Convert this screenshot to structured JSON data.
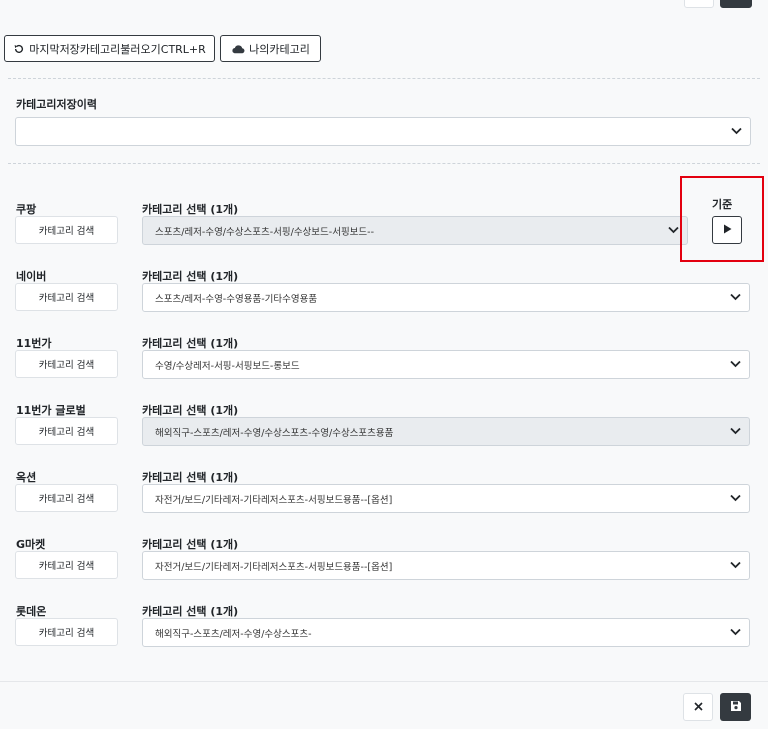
{
  "toolbar": {
    "load_last_label": "마지막저장카테고리불러오기CTRL+R",
    "my_category_label": "나의카테고리"
  },
  "history": {
    "label": "카테고리저장이력",
    "value": ""
  },
  "standard": {
    "label": "기준"
  },
  "markets": [
    {
      "name": "쿠팡",
      "search_label": "카테고리 검색",
      "select_label": "카테고리 선택 (1개)",
      "value": "스포츠/레저-수영/수상스포츠-서핑/수상보드-서핑보드--",
      "disabled": true
    },
    {
      "name": "네이버",
      "search_label": "카테고리 검색",
      "select_label": "카테고리 선택 (1개)",
      "value": "스포츠/레저-수영-수영용품-기타수영용품",
      "disabled": false
    },
    {
      "name": "11번가",
      "search_label": "카테고리 검색",
      "select_label": "카테고리 선택 (1개)",
      "value": "수영/수상레저-서핑-서핑보드-롱보드",
      "disabled": false
    },
    {
      "name": "11번가 글로벌",
      "search_label": "카테고리 검색",
      "select_label": "카테고리 선택 (1개)",
      "value": "해외직구-스포츠/레저-수영/수상스포츠-수영/수상스포츠용품",
      "disabled": true
    },
    {
      "name": "옥션",
      "search_label": "카테고리 검색",
      "select_label": "카테고리 선택 (1개)",
      "value": "자전거/보드/기타레저-기타레저스포츠-서핑보드용품--[옵션]",
      "disabled": false
    },
    {
      "name": "G마켓",
      "search_label": "카테고리 검색",
      "select_label": "카테고리 선택 (1개)",
      "value": "자전거/보드/기타레저-기타레저스포츠-서핑보드용품--[옵션]",
      "disabled": false
    },
    {
      "name": "롯데온",
      "search_label": "카테고리 검색",
      "select_label": "카테고리 선택 (1개)",
      "value": "해외직구-스포츠/레저-수영/수상스포츠-",
      "disabled": false
    }
  ],
  "colors": {
    "highlight": "#e3000f",
    "dark_button": "#343a40",
    "disabled_bg": "#e9ecef"
  }
}
